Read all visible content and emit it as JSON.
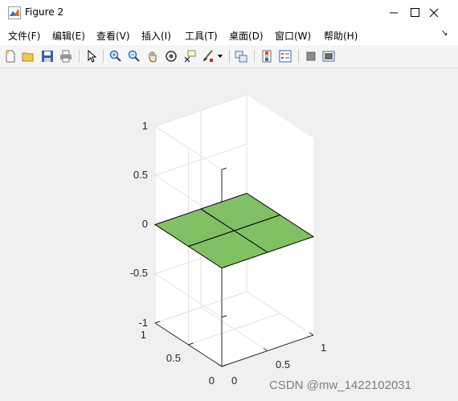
{
  "window": {
    "title": "Figure 2",
    "icon": "matlab-icon"
  },
  "menu": [
    {
      "label": "文件(F)"
    },
    {
      "label": "编辑(E)"
    },
    {
      "label": "查看(V)"
    },
    {
      "label": "插入(I)"
    },
    {
      "label": "工具(T)"
    },
    {
      "label": "桌面(D)"
    },
    {
      "label": "窗口(W)"
    },
    {
      "label": "帮助(H)"
    }
  ],
  "toolbar": [
    "new-figure-icon",
    "open-file-icon",
    "save-icon",
    "print-icon",
    "select-arrow-icon",
    "zoom-in-icon",
    "zoom-out-icon",
    "pan-icon",
    "rotate-3d-icon",
    "data-cursor-icon",
    "brush-icon",
    "link-plot-icon",
    "insert-colorbar-icon",
    "insert-legend-icon",
    "hide-plot-tools-icon",
    "show-plot-tools-icon"
  ],
  "plot": {
    "z_ticks": [
      "1",
      "0.5",
      "0",
      "-0.5",
      "-1"
    ],
    "y_ticks": [
      "1",
      "0.5",
      "0"
    ],
    "x_ticks": [
      "0",
      "0.5",
      "1"
    ],
    "surface_color": "#82c065",
    "grid": true
  },
  "chart_data": {
    "type": "surface",
    "title": "",
    "xlabel": "",
    "ylabel": "",
    "zlabel": "",
    "x": [
      0,
      0.5,
      1
    ],
    "y": [
      0,
      0.5,
      1
    ],
    "z": [
      [
        0,
        0,
        0
      ],
      [
        0,
        0,
        0
      ],
      [
        0,
        0,
        0
      ]
    ],
    "xlim": [
      0,
      1
    ],
    "ylim": [
      0,
      1
    ],
    "zlim": [
      -1,
      1
    ],
    "grid": true,
    "face_color": "#82c065"
  },
  "watermark": "CSDN @mw_1422102031"
}
